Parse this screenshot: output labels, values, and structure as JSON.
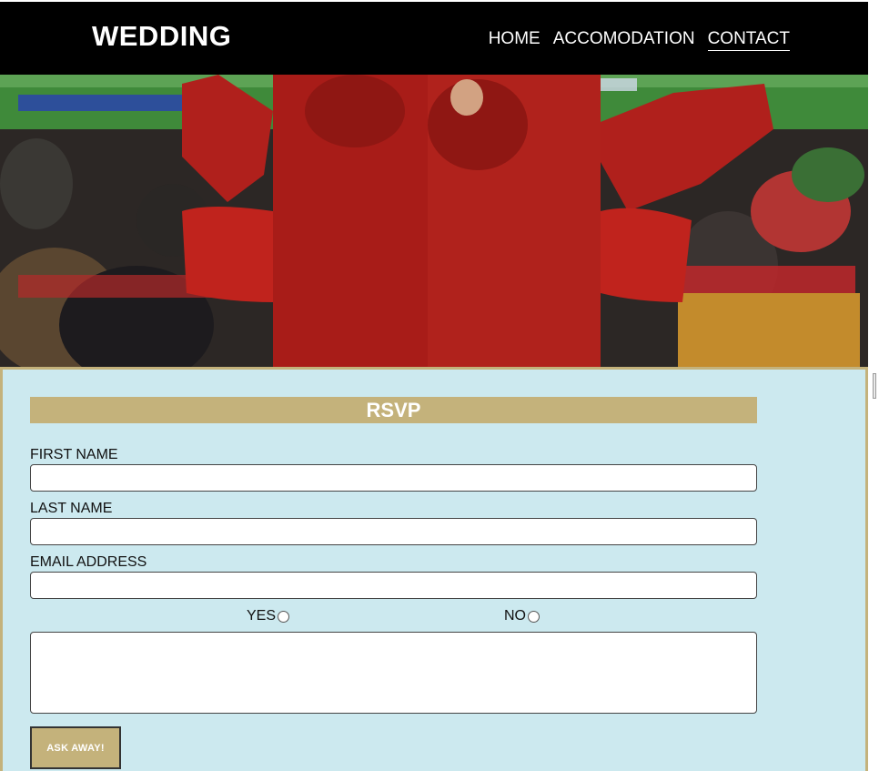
{
  "header": {
    "brand": "WEDDING",
    "nav": [
      {
        "label": "HOME",
        "active": false
      },
      {
        "label": "ACCOMODATION",
        "active": false
      },
      {
        "label": "CONTACT",
        "active": true
      }
    ]
  },
  "hero": {
    "description_icon": "photo-people-in-lobster-costumes-at-stadium"
  },
  "rsvp": {
    "title": "RSVP",
    "first_name_label": "FIRST NAME",
    "first_name_value": "",
    "last_name_label": "LAST NAME",
    "last_name_value": "",
    "email_label": "EMAIL ADDRESS",
    "email_value": "",
    "yes_label": "YES",
    "no_label": "NO",
    "message_value": "",
    "submit_label": "ASK AWAY!"
  },
  "colors": {
    "header_bg": "#000000",
    "accent_gold": "#c4b27b",
    "form_bg": "#cce9ef"
  }
}
